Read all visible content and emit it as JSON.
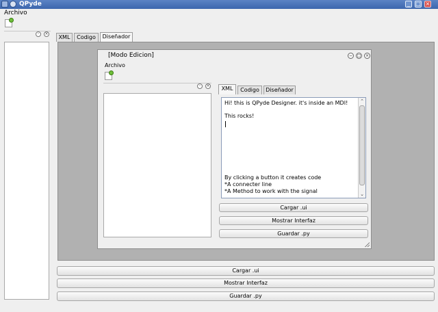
{
  "window": {
    "title": "QPyde"
  },
  "menu": {
    "file": "Archivo"
  },
  "tabs": {
    "xml": "XML",
    "codigo": "Codigo",
    "disenador": "Diseñador"
  },
  "mdi": {
    "title": "[Modo Edicion]",
    "menu_file": "Archivo",
    "tabs": {
      "xml": "XML",
      "codigo": "Codigo",
      "disenador": "Diseñador"
    },
    "editor_lines": [
      "Hi! this is QPyde Designer. it's inside an MDI!",
      "This rocks!",
      "By clicking a button it creates code",
      "*A connecter line",
      "*A Method to work with the signal"
    ],
    "buttons": {
      "load": "Cargar .ui",
      "show": "Mostrar Interfaz",
      "save": "Guardar .py"
    }
  },
  "main_buttons": {
    "load": "Cargar .ui",
    "show": "Mostrar Interfaz",
    "save": "Guardar .py"
  }
}
